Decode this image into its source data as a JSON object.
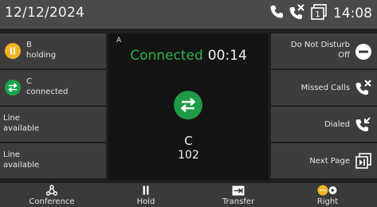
{
  "status_bar": {
    "date": "12/12/2024",
    "time": "14:08",
    "icons": [
      "phone-icon",
      "missed-call-icon",
      "voicemail-icon"
    ]
  },
  "lines_left": [
    {
      "title": "B",
      "status": "holding",
      "icon": "hold-icon",
      "color": "#f0b323"
    },
    {
      "title": "C",
      "status": "connected",
      "icon": "transfer-arrows-icon",
      "color": "#19a34a"
    },
    {
      "title": "Line",
      "status": "available"
    },
    {
      "title": "Line",
      "status": "available"
    }
  ],
  "call": {
    "line_label": "A",
    "state": "Connected",
    "duration": "00:14",
    "name": "C",
    "number": "102",
    "state_color": "#2fb34e"
  },
  "function_keys": [
    {
      "label_line1": "Do Not Disturb",
      "label_line2": "Off",
      "icon": "dnd-minus-icon"
    },
    {
      "label_line1": "Missed Calls",
      "label_line2": "",
      "icon": "missed-calls-icon"
    },
    {
      "label_line1": "Dialed",
      "label_line2": "",
      "icon": "dialed-calls-icon"
    },
    {
      "label_line1": "Next Page",
      "label_line2": "",
      "icon": "next-page-icon"
    }
  ],
  "softkeys": [
    {
      "label": "Conference",
      "icon": "conference-icon"
    },
    {
      "label": "Hold",
      "icon": "pause-icon"
    },
    {
      "label": "Transfer",
      "icon": "transfer-icon"
    },
    {
      "label": "Right",
      "icon": "more-right-icon"
    }
  ]
}
